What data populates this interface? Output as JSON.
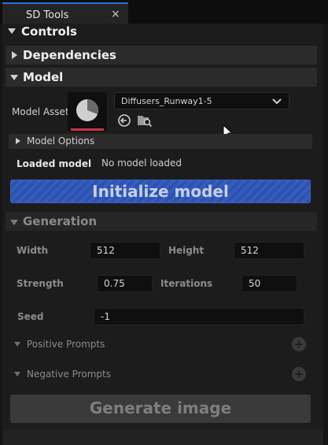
{
  "tab": {
    "title": "SD Tools",
    "close": "×"
  },
  "sections": {
    "controls": "Controls",
    "dependencies": "Dependencies",
    "model": "Model",
    "generation": "Generation"
  },
  "model": {
    "asset_label": "Model Asset",
    "asset_value": "Diffusers_Runway1-5",
    "options_label": "Model Options",
    "loaded_label": "Loaded model",
    "loaded_value": "No model loaded",
    "initialize_label": "Initialize model"
  },
  "generation": {
    "width_label": "Width",
    "width_value": "512",
    "height_label": "Height",
    "height_value": "512",
    "strength_label": "Strength",
    "strength_value": "0.75",
    "iterations_label": "Iterations",
    "iterations_value": "50",
    "seed_label": "Seed",
    "seed_value": "-1",
    "positive_label": "Positive Prompts",
    "negative_label": "Negative Prompts",
    "generate_label": "Generate image"
  },
  "colors": {
    "accent": "#2a6fd8",
    "button_blue": "#2e55b9",
    "thumb_underline": "#c8334e"
  }
}
